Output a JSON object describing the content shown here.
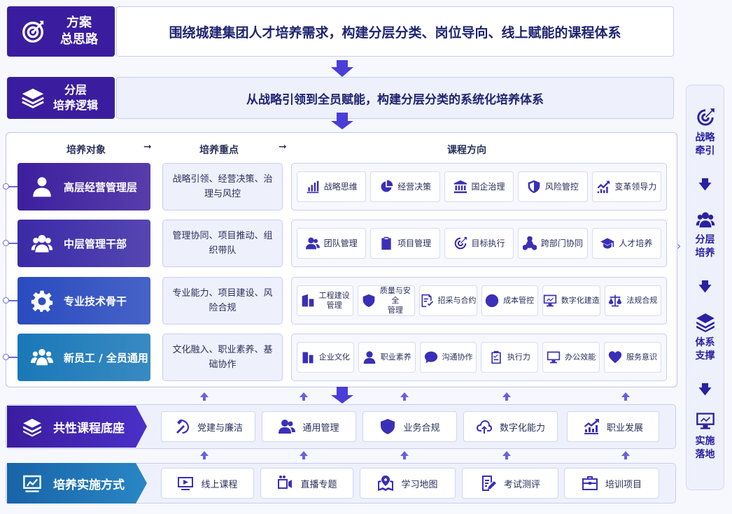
{
  "plan": {
    "label": "方案\n总思路",
    "text": "围绕城建集团人才培养需求，构建分层分类、岗位导向、线上赋能的课程体系"
  },
  "logic": {
    "label": "分层\n培养逻辑",
    "text": "从战略引领到全员赋能，构建分层分类的系统化培养体系"
  },
  "headers": {
    "target": "培养对象",
    "focus": "培养重点",
    "direction": "课程方向"
  },
  "rows": [
    {
      "label": "高层经营管理层",
      "icon": "person-tie-icon",
      "color": "#3d1f9e",
      "focus": "战略引领、经营决策、治理与风控",
      "courses": [
        {
          "label": "战略思维",
          "icon": "bar-chart-icon"
        },
        {
          "label": "经营决策",
          "icon": "pie-chart-icon"
        },
        {
          "label": "国企治理",
          "icon": "bank-icon"
        },
        {
          "label": "风险管控",
          "icon": "shield-icon"
        },
        {
          "label": "变革领导力",
          "icon": "trend-icon"
        }
      ]
    },
    {
      "label": "中层管理干部",
      "icon": "group-icon",
      "color": "#3b2aa6",
      "focus": "管理协同、项目推动、组织带队",
      "courses": [
        {
          "label": "团队管理",
          "icon": "team-icon"
        },
        {
          "label": "项目管理",
          "icon": "clipboard-icon"
        },
        {
          "label": "目标执行",
          "icon": "target-icon"
        },
        {
          "label": "跨部门协同",
          "icon": "network-icon"
        },
        {
          "label": "人才培养",
          "icon": "graduation-cap-icon"
        }
      ]
    },
    {
      "label": "专业技术骨干",
      "icon": "gear-icon",
      "color": "#2a4bbf",
      "focus": "专业能力、项目建设、风险合规",
      "courses": [
        {
          "label": "工程建设\n管理",
          "icon": "building-icon"
        },
        {
          "label": "质量与安全\n管理",
          "icon": "shield-check-icon"
        },
        {
          "label": "招采与合约",
          "icon": "document-check-icon"
        },
        {
          "label": "成本管控",
          "icon": "yen-icon"
        },
        {
          "label": "数字化建造",
          "icon": "monitor-icon"
        },
        {
          "label": "法规合规",
          "icon": "scale-icon"
        }
      ]
    },
    {
      "label": "新员工 / 全员通用",
      "icon": "people-icon",
      "color": "#1a78b8",
      "focus": "文化融入、职业素养、基础协作",
      "courses": [
        {
          "label": "企业文化",
          "icon": "office-icon"
        },
        {
          "label": "职业素养",
          "icon": "user-icon"
        },
        {
          "label": "沟通协作",
          "icon": "chat-icon"
        },
        {
          "label": "执行力",
          "icon": "checklist-icon"
        },
        {
          "label": "办公效能",
          "icon": "desktop-icon"
        },
        {
          "label": "服务意识",
          "icon": "heart-icon"
        }
      ]
    }
  ],
  "common": {
    "label": "共性课程底座",
    "items": [
      {
        "label": "党建与廉洁",
        "icon": "party-icon"
      },
      {
        "label": "通用管理",
        "icon": "team-icon"
      },
      {
        "label": "业务合规",
        "icon": "shield-check-icon"
      },
      {
        "label": "数字化能力",
        "icon": "cloud-icon"
      },
      {
        "label": "职业发展",
        "icon": "growth-icon"
      }
    ]
  },
  "impl": {
    "label": "培养实施方式",
    "items": [
      {
        "label": "线上课程",
        "icon": "video-icon"
      },
      {
        "label": "直播专题",
        "icon": "live-icon"
      },
      {
        "label": "学习地图",
        "icon": "map-icon"
      },
      {
        "label": "考试测评",
        "icon": "exam-icon"
      },
      {
        "label": "培训项目",
        "icon": "briefcase-icon"
      }
    ]
  },
  "sidebar": [
    {
      "label": "战略\n牵引",
      "icon": "target-icon"
    },
    {
      "label": "分层\n培养",
      "icon": "group-icon"
    },
    {
      "label": "体系\n支撑",
      "icon": "layers-icon"
    },
    {
      "label": "实施\n落地",
      "icon": "monitor-icon"
    }
  ],
  "colors": {
    "primary": "#3d1f9e",
    "accent": "#4a3ed8",
    "teal": "#1a78b8"
  }
}
